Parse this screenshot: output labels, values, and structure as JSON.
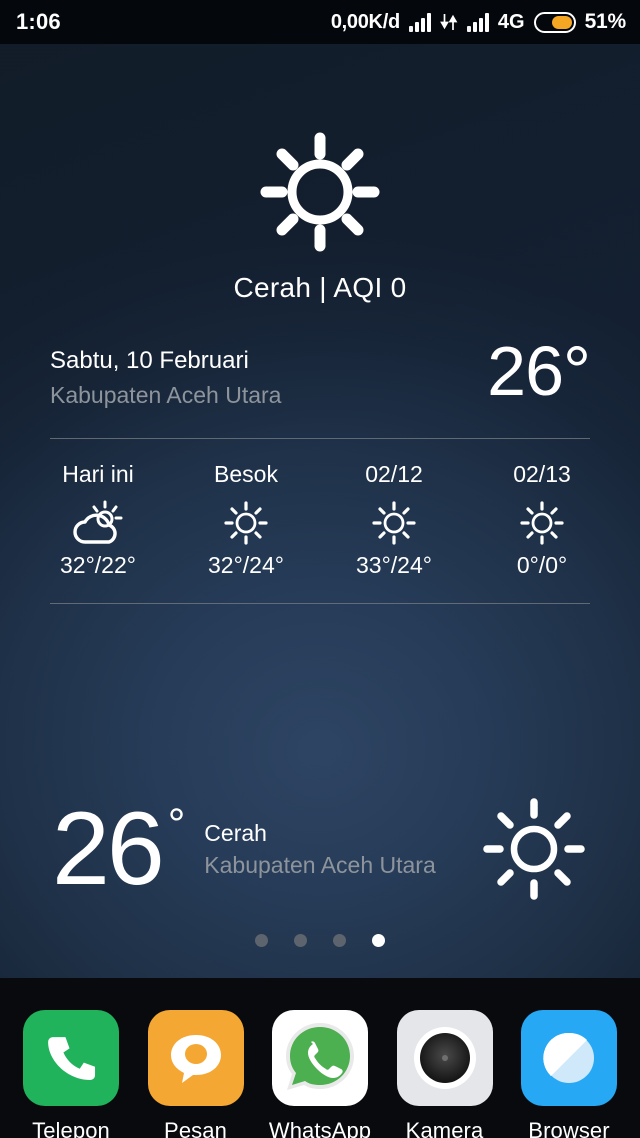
{
  "status_bar": {
    "clock": "1:06",
    "net_speed": "0,00K/d",
    "network_type": "4G",
    "battery_percent": "51%",
    "battery_level": 51,
    "icons": [
      "signal-bars-icon",
      "data-transfer-icon",
      "signal-bars-icon",
      "battery-icon"
    ]
  },
  "weather_widget": {
    "main_icon": "sun-icon",
    "condition_line": "Cerah | AQI 0",
    "date": "Sabtu, 10 Februari",
    "location": "Kabupaten Aceh Utara",
    "current_temp": "26°",
    "forecast": [
      {
        "day": "Hari ini",
        "icon": "sun-behind-cloud-icon",
        "temp": "32°/22°"
      },
      {
        "day": "Besok",
        "icon": "sun-icon",
        "temp": "32°/24°"
      },
      {
        "day": "02/12",
        "icon": "sun-icon",
        "temp": "33°/24°"
      },
      {
        "day": "02/13",
        "icon": "sun-icon",
        "temp": "0°/0°"
      }
    ]
  },
  "lower_weather": {
    "temp": "26",
    "degree": "°",
    "condition": "Cerah",
    "location": "Kabupaten Aceh Utara",
    "icon": "sun-icon"
  },
  "page_indicator": {
    "count": 4,
    "active_index": 3
  },
  "dock": {
    "apps": [
      {
        "label": "Telepon",
        "icon": "phone-icon",
        "color": "#21b25c"
      },
      {
        "label": "Pesan",
        "icon": "message-icon",
        "color": "#f5a733"
      },
      {
        "label": "WhatsApp",
        "icon": "whatsapp-icon",
        "color": "#ffffff"
      },
      {
        "label": "Kamera",
        "icon": "camera-icon",
        "color": "#e4e6ea"
      },
      {
        "label": "Browser",
        "icon": "compass-icon",
        "color": "#26a8f5"
      }
    ]
  },
  "colors": {
    "accent_orange": "#f5a623",
    "background_center": "#24364f",
    "background_edge": "#0a1016",
    "muted_text": "#8d949c"
  }
}
